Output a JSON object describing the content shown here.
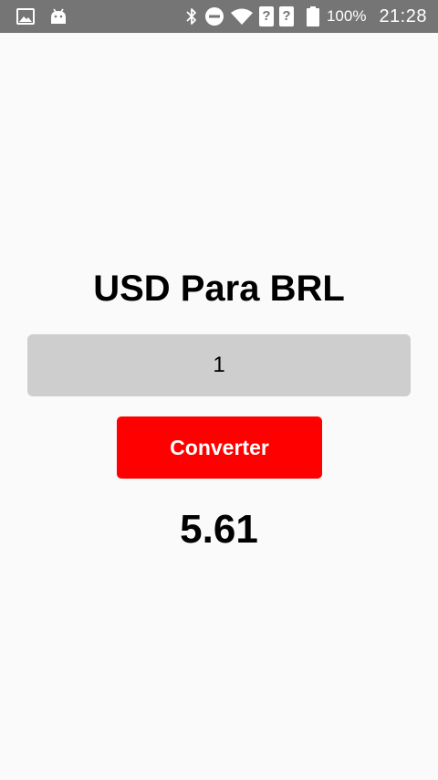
{
  "status_bar": {
    "left_icons": [
      "image-icon",
      "android-icon"
    ],
    "right_icons": [
      "bluetooth-icon",
      "do-not-disturb-icon",
      "wifi-icon",
      "no-sim-icon",
      "no-sim-icon",
      "battery-icon"
    ],
    "battery_percent": "100%",
    "time": "21:28",
    "background_color": "#757575"
  },
  "main": {
    "title": "USD Para BRL",
    "amount_input": {
      "value": "1"
    },
    "convert_button_label": "Converter",
    "convert_button_color": "#ff0000",
    "result": "5.61"
  }
}
